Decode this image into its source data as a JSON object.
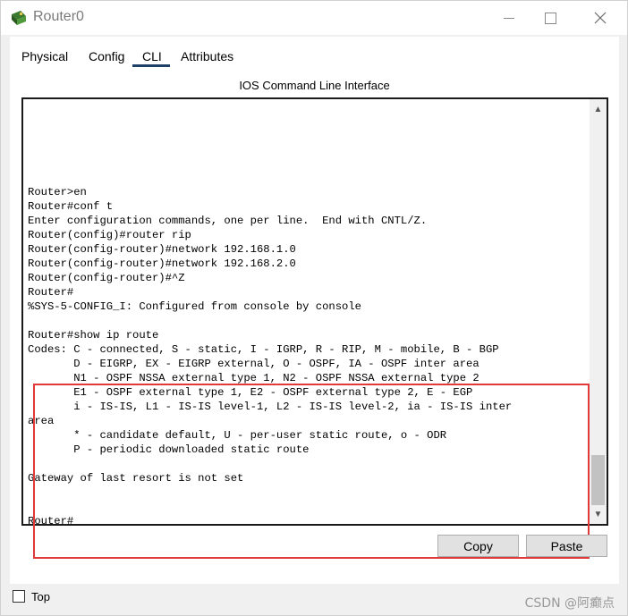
{
  "window": {
    "title": "Router0",
    "icon": "router-icon",
    "controls": [
      "minimize-icon",
      "maximize-icon",
      "close-icon"
    ]
  },
  "tabs": [
    {
      "label": "Physical",
      "active": false
    },
    {
      "label": "Config",
      "active": false
    },
    {
      "label": "CLI",
      "active": true
    },
    {
      "label": "Attributes",
      "active": false
    }
  ],
  "cli": {
    "title": "IOS Command Line Interface",
    "lines": [
      "Router>en",
      "Router#conf t",
      "Enter configuration commands, one per line.  End with CNTL/Z.",
      "Router(config)#router rip",
      "Router(config-router)#network 192.168.1.0",
      "Router(config-router)#network 192.168.2.0",
      "Router(config-router)#^Z",
      "Router#",
      "%SYS-5-CONFIG_I: Configured from console by console",
      "",
      "Router#show ip route",
      "Codes: C - connected, S - static, I - IGRP, R - RIP, M - mobile, B - BGP",
      "       D - EIGRP, EX - EIGRP external, O - OSPF, IA - OSPF inter area",
      "       N1 - OSPF NSSA external type 1, N2 - OSPF NSSA external type 2",
      "       E1 - OSPF external type 1, E2 - OSPF external type 2, E - EGP",
      "       i - IS-IS, L1 - IS-IS level-1, L2 - IS-IS level-2, ia - IS-IS inter",
      "area",
      "       * - candidate default, U - per-user static route, o - ODR",
      "       P - periodic downloaded static route",
      "",
      "Gateway of last resort is not set",
      "",
      "",
      "Router#"
    ],
    "highlight_color": "#e03a3a"
  },
  "buttons": {
    "copy": "Copy",
    "paste": "Paste"
  },
  "footer": {
    "top_label": "Top",
    "top_checked": false,
    "watermark": "CSDN @阿癫点"
  },
  "colors": {
    "tab_underline": "#1e3f66",
    "highlight_border": "#e03a3a"
  }
}
